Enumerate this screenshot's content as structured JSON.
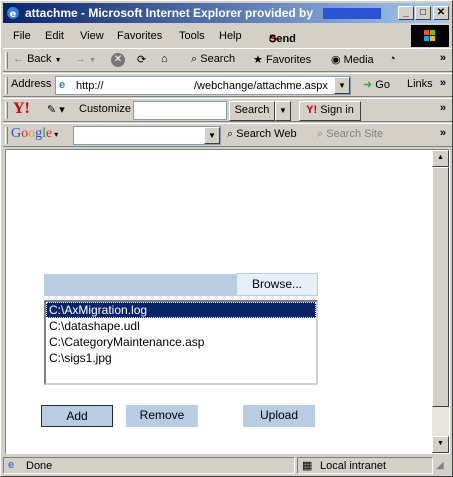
{
  "window": {
    "title": "attachme - Microsoft Internet Explorer provided by",
    "minimize": "_",
    "maximize": "□",
    "close": "✕"
  },
  "menu": {
    "items": [
      "File",
      "Edit",
      "View",
      "Favorites",
      "Tools",
      "Help"
    ],
    "send": "Send"
  },
  "toolbar": {
    "back": "Back",
    "search": "Search",
    "favorites": "Favorites",
    "media": "Media"
  },
  "address": {
    "label": "Address",
    "url_prefix": "http://",
    "url_path": "/webchange/attachme.aspx",
    "go": "Go",
    "links": "Links"
  },
  "yahoo": {
    "customize": "Customize",
    "search_button": "Search",
    "signin": "Sign in"
  },
  "google": {
    "logo": "Google",
    "search_web": "Search Web",
    "search_site": "Search Site"
  },
  "form": {
    "browse_label": "Browse...",
    "files": [
      "C:\\AxMigration.log",
      "C:\\datashape.udl",
      "C:\\CategoryMaintenance.asp",
      "C:\\sigs1.jpg"
    ],
    "selected_index": 0,
    "add_label": "Add",
    "remove_label": "Remove",
    "upload_label": "Upload"
  },
  "status": {
    "text": "Done",
    "zone": "Local intranet"
  },
  "colors": {
    "title_start": "#0a246a",
    "title_end": "#a6caf0",
    "form_accent": "#b8cce4",
    "selection": "#0a246a"
  }
}
